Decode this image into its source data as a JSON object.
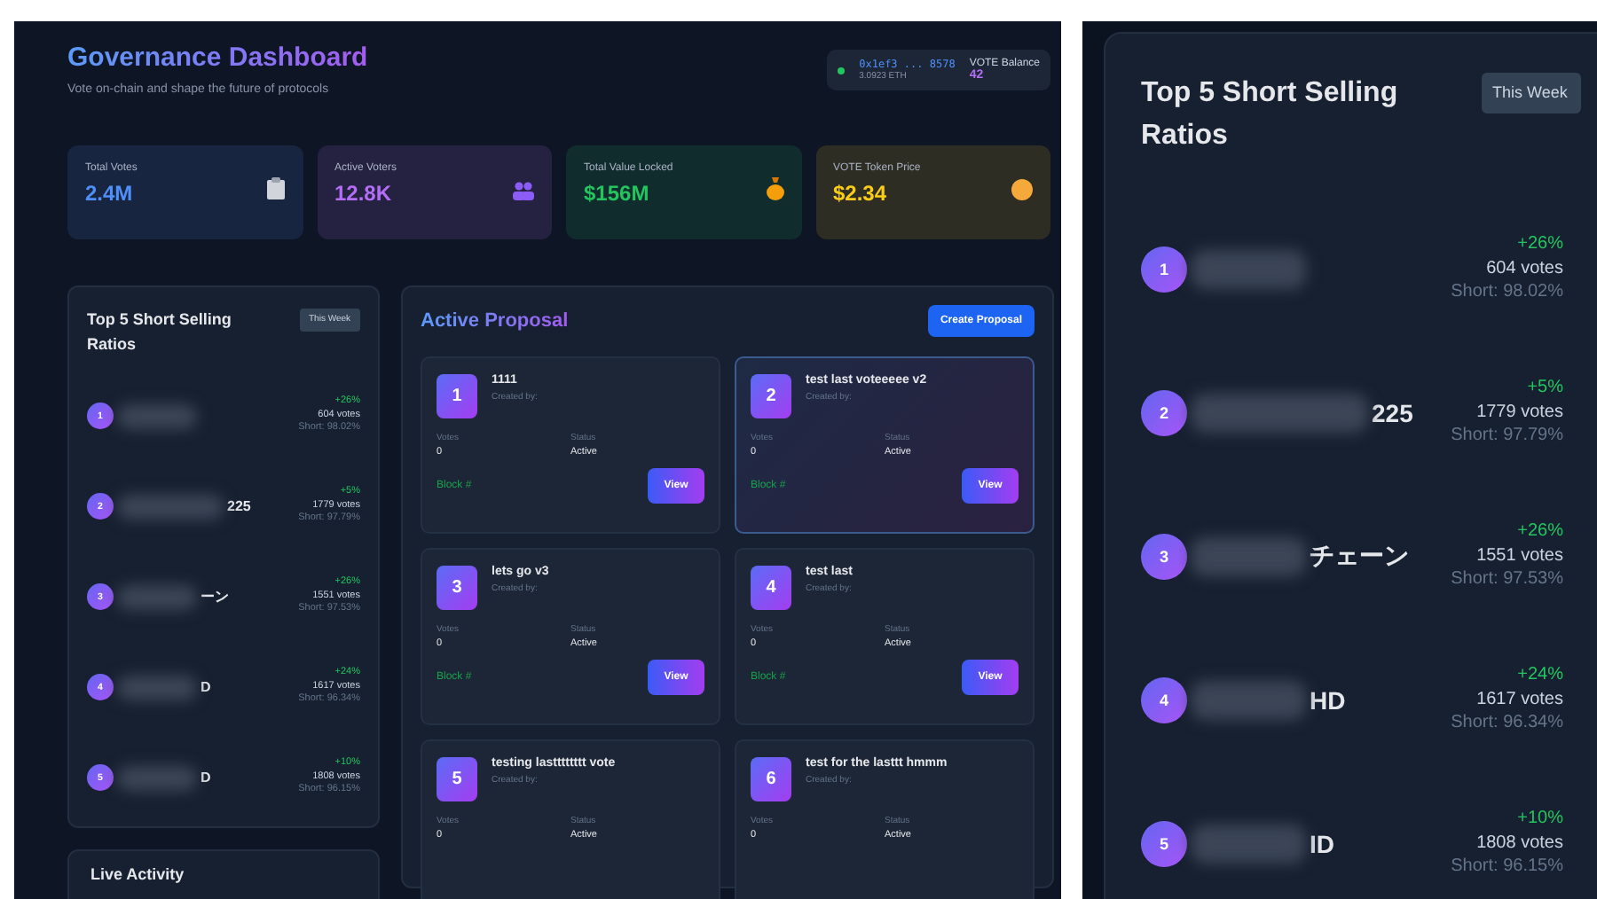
{
  "dashboard": {
    "header": {
      "title": "Governance Dashboard",
      "subtitle": "Vote on-chain and shape the future of protocols"
    },
    "wallet": {
      "address": "0x1ef3 ... 8578",
      "eth": "3.0923 ETH",
      "balance_label": "VOTE Balance",
      "balance": "42"
    },
    "stats": [
      {
        "label": "Total Votes",
        "value": "2.4M",
        "color": "#4f8ff7",
        "kind": "clipboard"
      },
      {
        "label": "Active Voters",
        "value": "12.8K",
        "color": "#b36ef5",
        "kind": "people"
      },
      {
        "label": "Total Value Locked",
        "value": "$156M",
        "color": "#22c55e",
        "kind": "moneybag"
      },
      {
        "label": "VOTE Token Price",
        "value": "$2.34",
        "color": "#facc15",
        "kind": "coin"
      }
    ],
    "ranking": {
      "title": "Top 5 Short Selling Ratios",
      "period": "This Week",
      "items": [
        {
          "rank": "1",
          "change": "+26%",
          "votes": "604 votes",
          "short": "Short: 98.02%"
        },
        {
          "rank": "2",
          "name_tail": "225",
          "change": "+5%",
          "votes": "1779 votes",
          "short": "Short: 97.79%"
        },
        {
          "rank": "3",
          "name_tail": "ーン",
          "change": "+26%",
          "votes": "1551 votes",
          "short": "Short: 97.53%"
        },
        {
          "rank": "4",
          "name_tail": "D",
          "change": "+24%",
          "votes": "1617 votes",
          "short": "Short: 96.34%"
        },
        {
          "rank": "5",
          "name_tail": "D",
          "change": "+10%",
          "votes": "1808 votes",
          "short": "Short: 96.15%"
        }
      ]
    },
    "live_activity": {
      "title": "Live Activity"
    },
    "proposals": {
      "title": "Active Proposal",
      "button": "Create Proposal",
      "items": [
        {
          "number": "1",
          "title": "1111",
          "created": "Created by:",
          "votes_label": "Votes",
          "votes": "0",
          "status_label": "Status",
          "status": "Active",
          "block": "Block #",
          "view": "View",
          "selected": false
        },
        {
          "number": "2",
          "title": "test last voteeeee v2",
          "created": "Created by:",
          "votes_label": "Votes",
          "votes": "0",
          "status_label": "Status",
          "status": "Active",
          "block": "Block #",
          "view": "View",
          "selected": true
        },
        {
          "number": "3",
          "title": "lets go v3",
          "created": "Created by:",
          "votes_label": "Votes",
          "votes": "0",
          "status_label": "Status",
          "status": "Active",
          "block": "Block #",
          "view": "View",
          "selected": false
        },
        {
          "number": "4",
          "title": "test last",
          "created": "Created by:",
          "votes_label": "Votes",
          "votes": "0",
          "status_label": "Status",
          "status": "Active",
          "block": "Block #",
          "view": "View",
          "selected": false
        },
        {
          "number": "5",
          "title": "testing lastttttttt vote",
          "created": "Created by:",
          "votes_label": "Votes",
          "votes": "0",
          "status_label": "Status",
          "status": "Active",
          "selected": false
        },
        {
          "number": "6",
          "title": "test for the lasttt hmmm",
          "created": "Created by:",
          "votes_label": "Votes",
          "votes": "0",
          "status_label": "Status",
          "status": "Active",
          "selected": false
        }
      ]
    }
  },
  "zoomed_ranking": {
    "title": "Top 5 Short Selling Ratios",
    "period": "This Week",
    "items": [
      {
        "rank": "1",
        "change": "+26%",
        "votes": "604 votes",
        "short": "Short: 98.02%"
      },
      {
        "rank": "2",
        "name_tail": "225",
        "change": "+5%",
        "votes": "1779 votes",
        "short": "Short: 97.79%"
      },
      {
        "rank": "3",
        "name_tail": "チェーン",
        "change": "+26%",
        "votes": "1551 votes",
        "short": "Short: 97.53%"
      },
      {
        "rank": "4",
        "name_tail": "HD",
        "change": "+24%",
        "votes": "1617 votes",
        "short": "Short: 96.34%"
      },
      {
        "rank": "5",
        "name_tail": "ID",
        "change": "+10%",
        "votes": "1808 votes",
        "short": "Short: 96.15%"
      }
    ]
  }
}
